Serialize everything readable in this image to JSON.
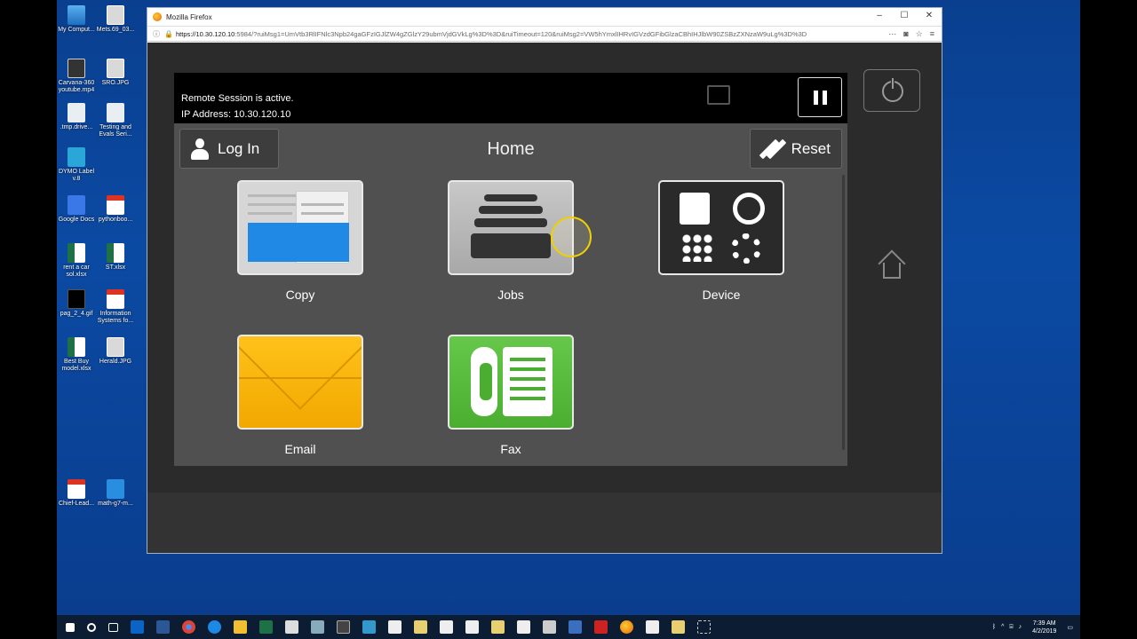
{
  "desktop": {
    "icons": [
      {
        "label": "My Comput...",
        "glyph": "g-pc"
      },
      {
        "label": "Mets.69_03...",
        "glyph": "g-img"
      },
      {
        "label": "Carvana-360 youtube.mp4",
        "glyph": "g-vid"
      },
      {
        "label": "SRO.JPG",
        "glyph": "g-img"
      },
      {
        "label": ".tmp.drive...",
        "glyph": "g-file"
      },
      {
        "label": "Testing and Evals Seri...",
        "glyph": "g-file"
      },
      {
        "label": "DYMO Label v.8",
        "glyph": "g-dymo"
      },
      {
        "label": "Google Docs",
        "glyph": "g-gdoc"
      },
      {
        "label": "pythonboo...",
        "glyph": "g-pdf"
      },
      {
        "label": "rent a car sol.xlsx",
        "glyph": "g-xls"
      },
      {
        "label": "ST.xlsx",
        "glyph": "g-xls"
      },
      {
        "label": "pag_2_4.gif",
        "glyph": "g-black"
      },
      {
        "label": "Information Systems fo...",
        "glyph": "g-pdf"
      },
      {
        "label": "Best Buy model.xlsx",
        "glyph": "g-xls"
      },
      {
        "label": "Herald.JPG",
        "glyph": "g-img"
      },
      {
        "label": "Chief-Lead...",
        "glyph": "g-pdf"
      },
      {
        "label": "math-g7-m...",
        "glyph": "g-ie"
      }
    ]
  },
  "browser": {
    "title": "Mozilla Firefox",
    "url_host": "https://10.30.120.10",
    "url_rest": ":5984/?ruiMsg1=UmVtb3RlIFNlc3Npb24gaGFzIGJlZW4gZGlzY29ubmVjdGVkLg%3D%3D&ruiTimeout=120&ruiMsg2=VW5hYmxlIHRvIGVzdGFibGlzaCBhIHJlbW90ZSBzZXNzaW9uLg%3D%3D",
    "controls": {
      "minimize": "–",
      "maximize": "☐",
      "close": "✕"
    }
  },
  "remote": {
    "status_line1": "Remote Session is active.",
    "status_line2": "IP Address: 10.30.120.10"
  },
  "panel": {
    "title": "Home",
    "login_label": "Log In",
    "reset_label": "Reset",
    "apps": [
      {
        "label": "Copy"
      },
      {
        "label": "Jobs"
      },
      {
        "label": "Device"
      },
      {
        "label": "Email"
      },
      {
        "label": "Fax"
      }
    ]
  },
  "taskbar": {
    "time": "7:39 AM",
    "date": "4/2/2019"
  }
}
